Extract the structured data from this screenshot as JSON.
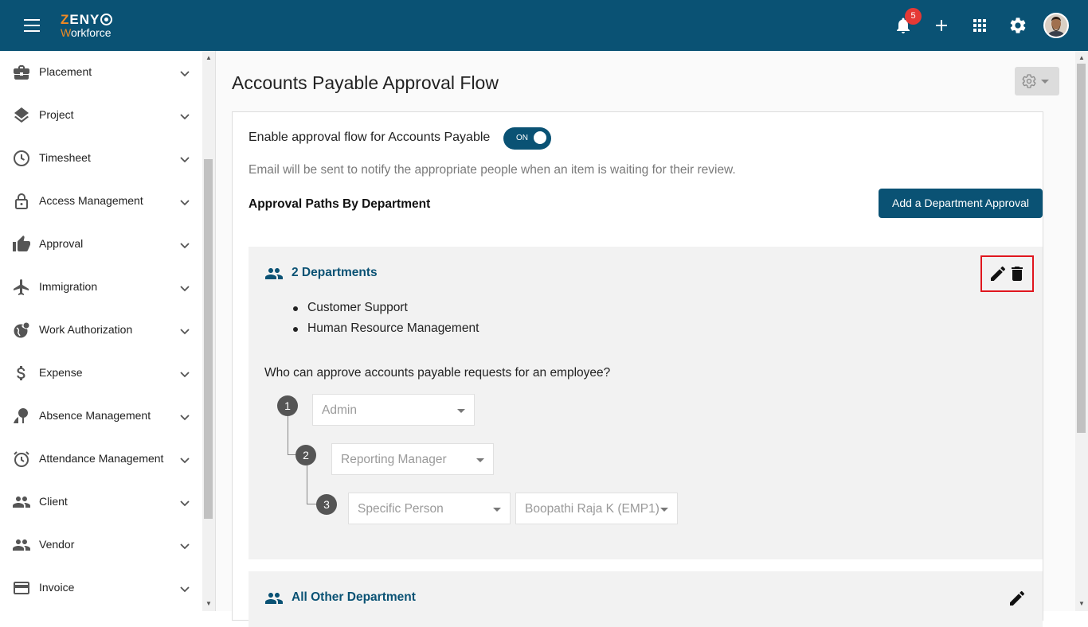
{
  "brand": {
    "name_prefix": "Z",
    "name_rest": "ENY",
    "sub_prefix": "W",
    "sub_rest": "orkforce"
  },
  "topbar": {
    "notifications_count": "5"
  },
  "sidebar": {
    "items": [
      {
        "label": "Placement",
        "icon": "briefcase-icon"
      },
      {
        "label": "Project",
        "icon": "layers-icon"
      },
      {
        "label": "Timesheet",
        "icon": "clock-icon"
      },
      {
        "label": "Access Management",
        "icon": "lock-icon"
      },
      {
        "label": "Approval",
        "icon": "thumbs-up-icon"
      },
      {
        "label": "Immigration",
        "icon": "airplane-icon"
      },
      {
        "label": "Work Authorization",
        "icon": "globe-icon"
      },
      {
        "label": "Expense",
        "icon": "dollar-icon"
      },
      {
        "label": "Absence Management",
        "icon": "beach-icon"
      },
      {
        "label": "Attendance Management",
        "icon": "alarm-icon"
      },
      {
        "label": "Client",
        "icon": "people-icon"
      },
      {
        "label": "Vendor",
        "icon": "people-icon"
      },
      {
        "label": "Invoice",
        "icon": "card-icon"
      }
    ]
  },
  "main": {
    "title": "Accounts Payable Approval Flow",
    "enable_label": "Enable approval flow for Accounts Payable",
    "toggle_label": "ON",
    "email_note": "Email will be sent to notify the appropriate people when an item is waiting for their review.",
    "paths_title": "Approval Paths By Department",
    "add_button": "Add a Department Approval",
    "group1": {
      "heading": "2 Departments",
      "departments": [
        "Customer Support",
        "Human Resource Management"
      ],
      "question": "Who can approve accounts payable requests for an employee?",
      "steps": [
        {
          "num": "1",
          "value": "Admin"
        },
        {
          "num": "2",
          "value": "Reporting Manager"
        },
        {
          "num": "3",
          "value": "Specific Person",
          "person": "Boopathi Raja K (EMP1)"
        }
      ]
    },
    "group2": {
      "heading": "All Other Department"
    }
  },
  "colors": {
    "primary": "#0a5274",
    "accent": "#f08a24",
    "badge": "#e53935",
    "highlight": "#e0161e"
  }
}
